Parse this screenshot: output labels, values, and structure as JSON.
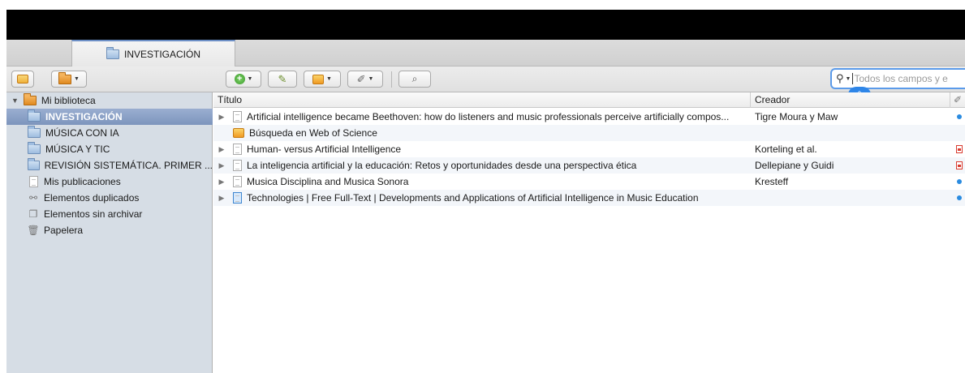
{
  "tab": {
    "label": "INVESTIGACIÓN",
    "icon": "folder-icon"
  },
  "toolbar": {
    "new_collection_icon": "new-collection-icon",
    "library_menu_icon": "library-menu-icon",
    "new_item_icon": "new-item-icon",
    "add_by_identifier_icon": "magic-wand-icon",
    "new_note_icon": "new-note-icon",
    "attach_icon": "paperclip-icon",
    "advanced_search_icon": "magnifier-icon"
  },
  "search": {
    "placeholder": "Todos los campos y e",
    "icon": "search-icon"
  },
  "sidebar": {
    "root": {
      "label": "Mi biblioteca",
      "icon": "library-icon"
    },
    "items": [
      {
        "label": "INVESTIGACIÓN",
        "icon": "folder-icon",
        "selected": true
      },
      {
        "label": "MÚSICA CON IA",
        "icon": "folder-icon"
      },
      {
        "label": "MÚSICA Y TIC",
        "icon": "folder-icon"
      },
      {
        "label": "REVISIÓN SISTEMÁTICA. PRIMER ...",
        "icon": "folder-icon"
      },
      {
        "label": "Mis publicaciones",
        "icon": "document-icon"
      },
      {
        "label": "Elementos duplicados",
        "icon": "duplicates-icon"
      },
      {
        "label": "Elementos sin archivar",
        "icon": "unfiled-icon"
      },
      {
        "label": "Papelera",
        "icon": "trash-icon"
      }
    ]
  },
  "columns": {
    "title": "Título",
    "creator": "Creador",
    "attachment_icon": "paperclip-icon"
  },
  "rows": [
    {
      "title": "Artificial intelligence became Beethoven: how do listeners and music professionals perceive artificially compos...",
      "creator": "Tigre Moura y Maw",
      "type": "document",
      "expandable": true,
      "attachment": "link-dot"
    },
    {
      "title": "Búsqueda en Web of Science",
      "creator": "",
      "type": "saved-search",
      "expandable": false,
      "attachment": ""
    },
    {
      "title": "Human- versus Artificial Intelligence",
      "creator": "Korteling et al.",
      "type": "document",
      "expandable": true,
      "attachment": "pdf"
    },
    {
      "title": "La inteligencia artificial y la educación: Retos y oportunidades desde una perspectiva ética",
      "creator": "Dellepiane y Guidi",
      "type": "document",
      "expandable": true,
      "attachment": "pdf"
    },
    {
      "title": "Musica Disciplina and Musica Sonora",
      "creator": "Kresteff",
      "type": "document",
      "expandable": true,
      "attachment": "link-dot"
    },
    {
      "title": "Technologies | Free Full-Text | Developments and Applications of Artificial Intelligence in Music Education",
      "creator": "",
      "type": "webpage",
      "expandable": true,
      "attachment": "link-dot"
    }
  ],
  "colors": {
    "accent": "#5b9bea",
    "selection": "#8ba0c5",
    "sidebar_bg": "#d6dde5"
  }
}
